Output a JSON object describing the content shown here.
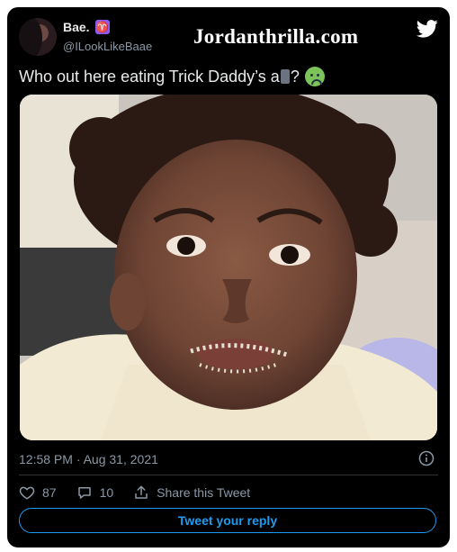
{
  "tweet": {
    "display_name": "Bae.",
    "zodiac_badge": "♈",
    "handle": "@ILookLikeBaae",
    "text_before": "Who out here eating Trick Daddy’s a",
    "text_after": "?",
    "timestamp": "12:58 PM · Aug 31, 2021",
    "likes": "87",
    "replies": "10",
    "share_label": "Share this Tweet",
    "reply_button_label": "Tweet your reply"
  },
  "watermark": "Jordanthrilla.com",
  "icons": {
    "brand": "twitter-bird-icon",
    "emoji": "sick-face-emoji",
    "like": "heart-icon",
    "reply": "speech-bubble-icon",
    "share": "share-upload-icon",
    "info": "info-icon"
  },
  "colors": {
    "background": "#000000",
    "accent": "#1d9bf0",
    "text": "#e7e9ea",
    "muted": "#8b98a5",
    "badge": "#8b5cf6"
  }
}
